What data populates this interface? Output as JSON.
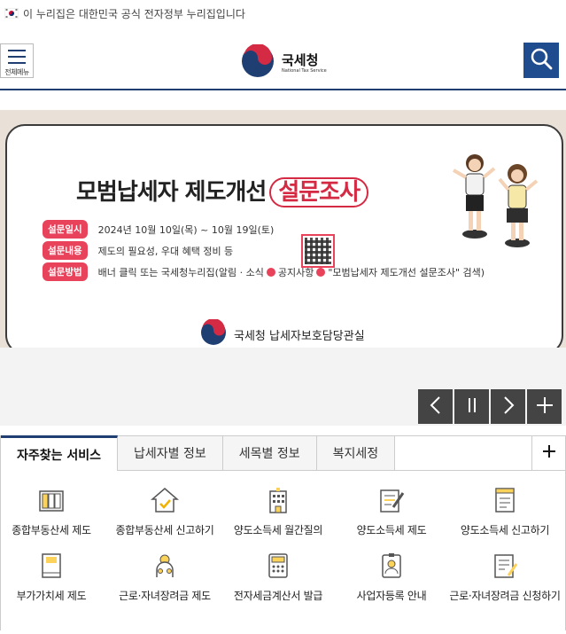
{
  "gov_banner": {
    "text": "이 누리집은 대한민국 공식 전자정부 누리집입니다"
  },
  "header": {
    "menu_label": "전체메뉴",
    "logo_ko": "국세청",
    "logo_en": "National Tax Service"
  },
  "hero": {
    "title_main": "모범납세자 제도개선",
    "title_highlight": "설문조사",
    "rows": [
      {
        "tag": "설문일시",
        "text": "2024년 10월 10일(목) ~ 10월 19일(토)"
      },
      {
        "tag": "설문내용",
        "text": "제도의 필요성, 우대 혜택 정비 등"
      },
      {
        "tag": "설문방법",
        "text_a": "배너 클릭 또는 국세청누리집(알림 · 소식",
        "text_b": "공지사항",
        "text_c": "\"모범납세자 제도개선 설문조사\" 검색)"
      }
    ],
    "footer": "국세청 납세자보호담당관실"
  },
  "tabs": [
    {
      "label": "자주찾는 서비스",
      "active": true
    },
    {
      "label": "납세자별 정보",
      "active": false
    },
    {
      "label": "세목별 정보",
      "active": false
    },
    {
      "label": "복지세정",
      "active": false
    }
  ],
  "services": [
    {
      "label": "종합부동산세 제도",
      "icon": "building-icon"
    },
    {
      "label": "종합부동산세 신고하기",
      "icon": "house-check-icon"
    },
    {
      "label": "양도소득세 월간질의",
      "icon": "office-building-icon"
    },
    {
      "label": "양도소득세 제도",
      "icon": "document-pen-icon"
    },
    {
      "label": "양도소득세 신고하기",
      "icon": "report-icon"
    },
    {
      "label": "부가가치세 제도",
      "icon": "book-icon"
    },
    {
      "label": "근로·자녀장려금 제도",
      "icon": "family-icon"
    },
    {
      "label": "전자세금계산서 발급",
      "icon": "calculator-icon"
    },
    {
      "label": "사업자등록 안내",
      "icon": "id-card-icon"
    },
    {
      "label": "근로·자녀장려금 신청하기",
      "icon": "application-icon"
    }
  ],
  "colors": {
    "navy": "#1f3f73",
    "accent_red": "#e8435b",
    "control_gray": "#444444"
  }
}
